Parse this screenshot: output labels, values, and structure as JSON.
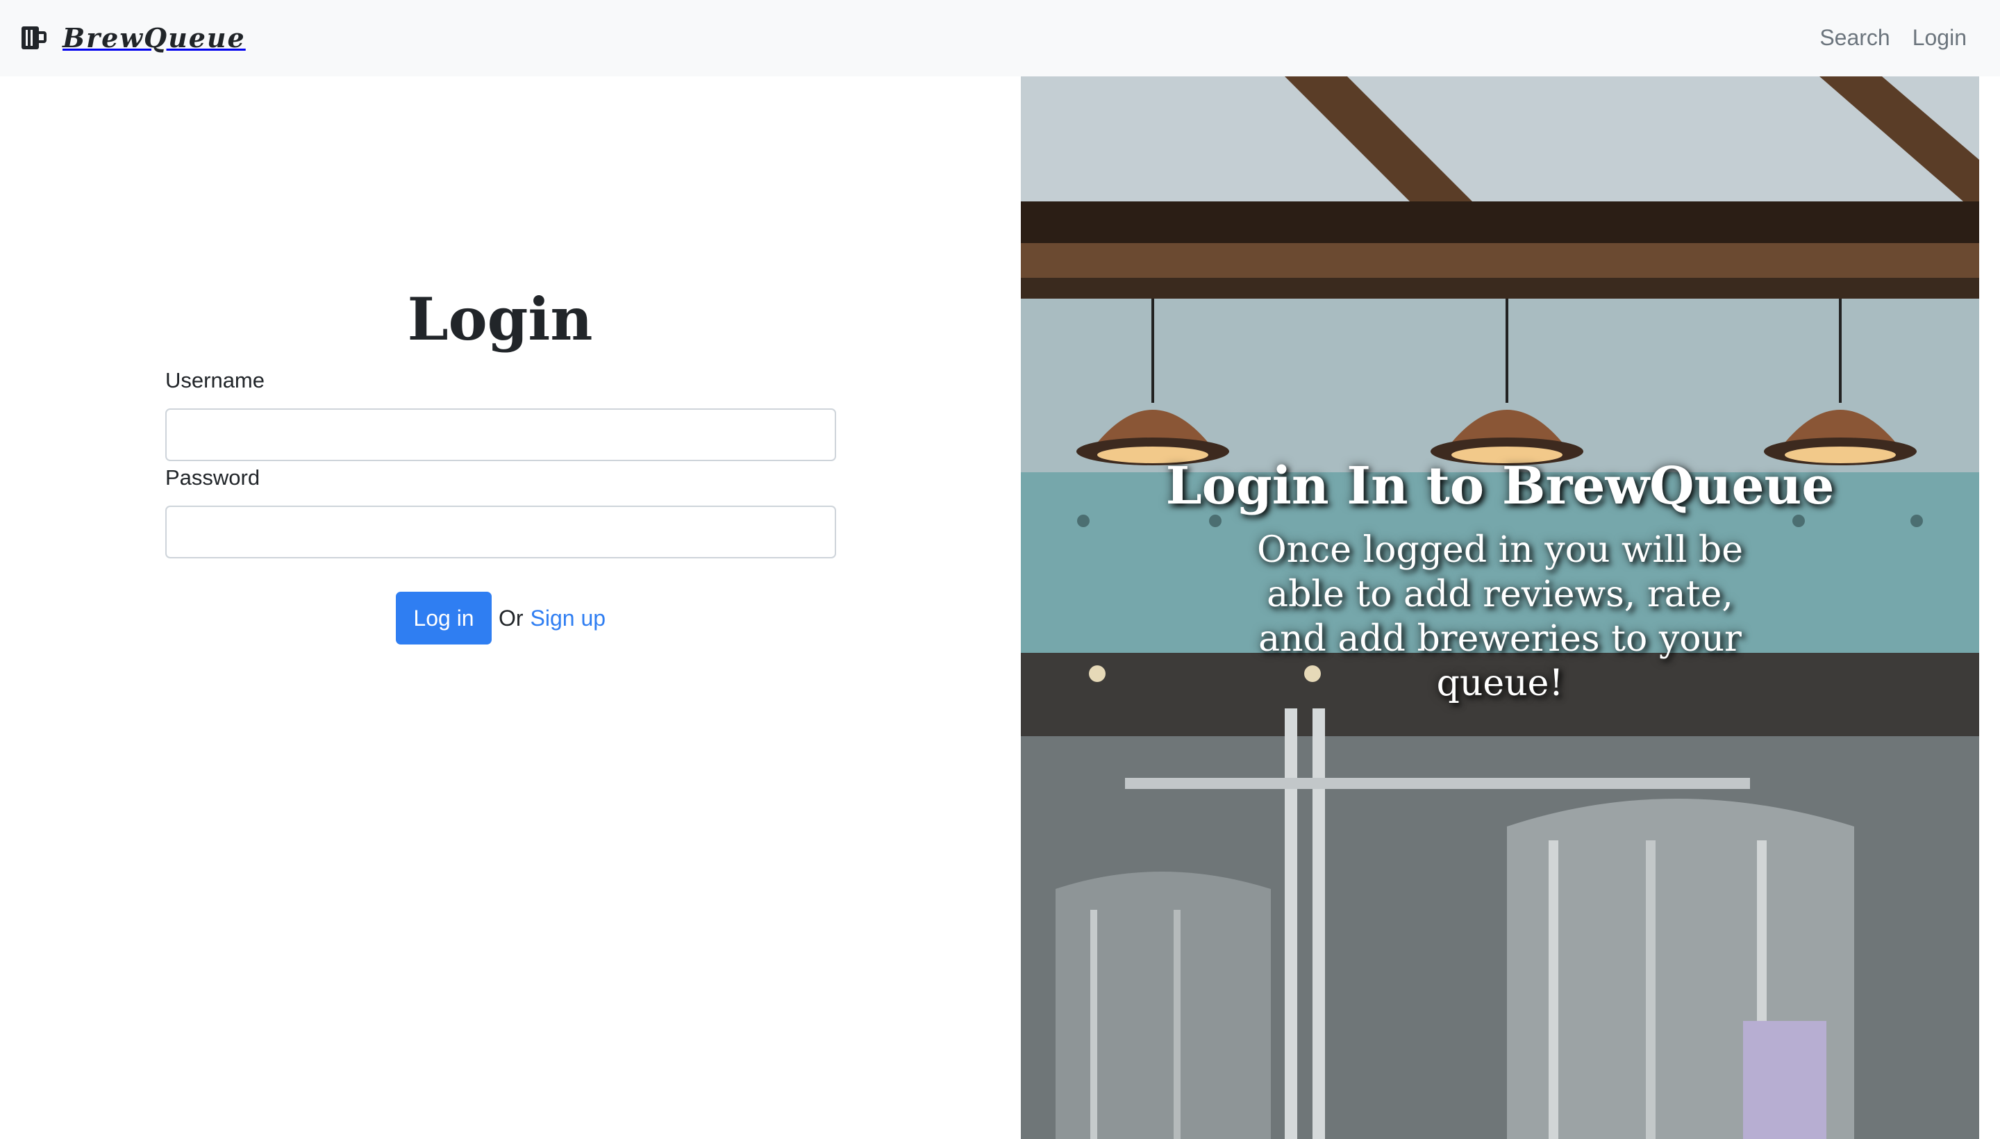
{
  "navbar": {
    "brand_icon": "beer-mug-icon",
    "brand_name": "BrewQueue",
    "links": [
      {
        "label": "Search"
      },
      {
        "label": "Login"
      }
    ]
  },
  "login_form": {
    "title": "Login",
    "username_label": "Username",
    "username_value": "",
    "password_label": "Password",
    "password_value": "",
    "submit_label": "Log in",
    "or_text": "Or",
    "signup_label": "Sign up"
  },
  "hero": {
    "title": "Login In to BrewQueue",
    "subtitle": "Once logged in you will be able to add reviews, rate, and add breweries to your queue!"
  },
  "colors": {
    "primary": "#2f7ef2",
    "navbar_bg": "#f8f9fa",
    "text": "#212529",
    "muted": "#6c757d"
  }
}
